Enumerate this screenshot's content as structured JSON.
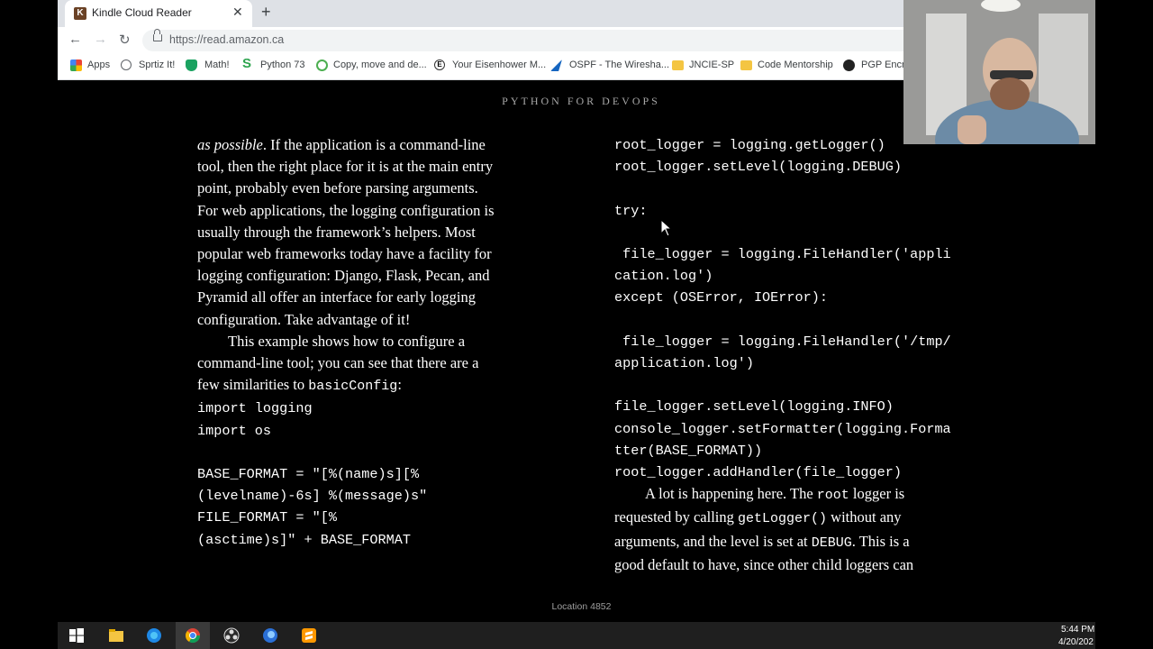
{
  "tab": {
    "title": "Kindle Cloud Reader",
    "favicon": "K"
  },
  "address_bar": {
    "url": "https://read.amazon.ca"
  },
  "bookmarks": [
    {
      "label": "Apps",
      "icon": "apps-grid-icon",
      "color": "#ea4335"
    },
    {
      "label": "Sprtiz It!",
      "icon": "globe-icon",
      "color": "#5f6368"
    },
    {
      "label": "Math!",
      "icon": "shield-icon",
      "color": "#1aa260"
    },
    {
      "label": "Python 73",
      "icon": "s-logo-icon",
      "color": "#2ea44f"
    },
    {
      "label": "Copy, move and de...",
      "icon": "refresh-logo-icon",
      "color": "#4caf50"
    },
    {
      "label": "Your Eisenhower M...",
      "icon": "e-logo-icon",
      "color": "#333333"
    },
    {
      "label": "OSPF - The Wiresha...",
      "icon": "wireshark-fin-icon",
      "color": "#1565c0"
    },
    {
      "label": "JNCIE-SP",
      "icon": "folder-icon",
      "color": "#f4c542"
    },
    {
      "label": "Code Mentorship",
      "icon": "folder-icon",
      "color": "#f4c542"
    },
    {
      "label": "PGP Encry",
      "icon": "pgp-logo-icon",
      "color": "#222222"
    }
  ],
  "book": {
    "running_title": "PYTHON FOR DEVOPS",
    "left_col": {
      "p1_italic": "as possible",
      "p1_rest": ". If the application is a command-line\ntool, then the right place for it is at the main entry\npoint, probably even before parsing arguments.\nFor web applications, the logging configuration is\nusually through the framework’s helpers. Most\npopular web frameworks today have a facility for\nlogging configuration: Django, Flask, Pecan, and\nPyramid all offer an interface for early logging\nconfiguration. Take advantage of it!",
      "p2_text": "This example shows how to configure a\ncommand-line tool; you can see that there are a\nfew similarities to ",
      "p2_code": "basicConfig",
      "p2_end": ":",
      "code": "import logging\nimport os\n\nBASE_FORMAT = \"[%(name)s][%\n(levelname)-6s] %(message)s\"\nFILE_FORMAT = \"[%\n(asctime)s]\" + BASE_FORMAT"
    },
    "right_col": {
      "code": "root_logger = logging.getLogger()\nroot_logger.setLevel(logging.DEBUG)\n\ntry:\n\n file_logger = logging.FileHandler('appli\ncation.log')\nexcept (OSError, IOError):\n\n file_logger = logging.FileHandler('/tmp/\napplication.log')\n\nfile_logger.setLevel(logging.INFO)\nconsole_logger.setFormatter(logging.Forma\ntter(BASE_FORMAT))\nroot_logger.addHandler(file_logger)",
      "p_a": "A lot is happening here. The ",
      "p_code1": "root",
      "p_b": " logger is\nrequested by calling ",
      "p_code2": "getLogger()",
      "p_c": " without any\narguments, and the level is set at ",
      "p_code3": "DEBUG",
      "p_d": ". This is a\ngood default to have, since other child loggers can"
    },
    "location": "Location 4852"
  },
  "taskbar": {
    "icons": [
      "windows-start-icon",
      "file-explorer-icon",
      "edge-icon",
      "chrome-icon",
      "obs-icon",
      "firefox-dev-icon",
      "sublime-text-icon"
    ],
    "time": "5:44 PM",
    "date": "4/20/202"
  }
}
